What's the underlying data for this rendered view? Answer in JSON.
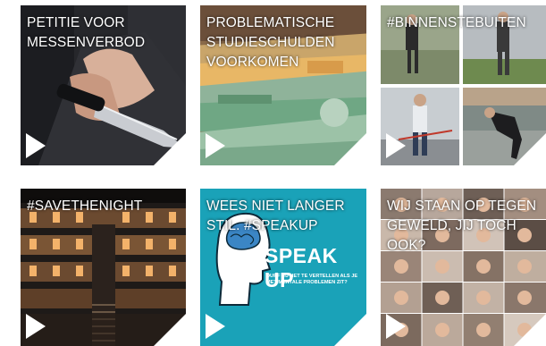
{
  "tiles": [
    {
      "title": "PETITIE VOOR MESSENVERBOD",
      "image": "hand-holding-knife-behind-back",
      "media": "video"
    },
    {
      "title": "PROBLEMATISCHE STUDIESCHULDEN VOORKOMEN",
      "image": "stack-of-euro-banknotes",
      "media": "video"
    },
    {
      "title": "#BINNENSTEBUITEN",
      "image": "collage-people-outdoor-exercise",
      "media": "video"
    },
    {
      "title": "#SAVETHENIGHT",
      "image": "theatre-balconies-interior",
      "media": "video"
    },
    {
      "title": "WEES NIET LANGER STIL. #SPEAKUP",
      "image": "head-with-brain-illustration",
      "media": "video",
      "poster": {
        "headline": "SPEAK UP",
        "subline": "DURF JIJ HET TE VERTELLEN ALS JE MET MENTALE PROBLEMEN ZIT?"
      }
    },
    {
      "title": "WIJ STAAN OP TEGEN GEWELD, JIJ TOCH OOK?",
      "image": "grid-of-video-call-faces",
      "media": "video"
    }
  ],
  "colors": {
    "overlay_text": "#ffffff",
    "speakup_teal": "#1aa2b8",
    "page_background": "#ffffff"
  },
  "icons": {
    "play": "play-icon"
  }
}
